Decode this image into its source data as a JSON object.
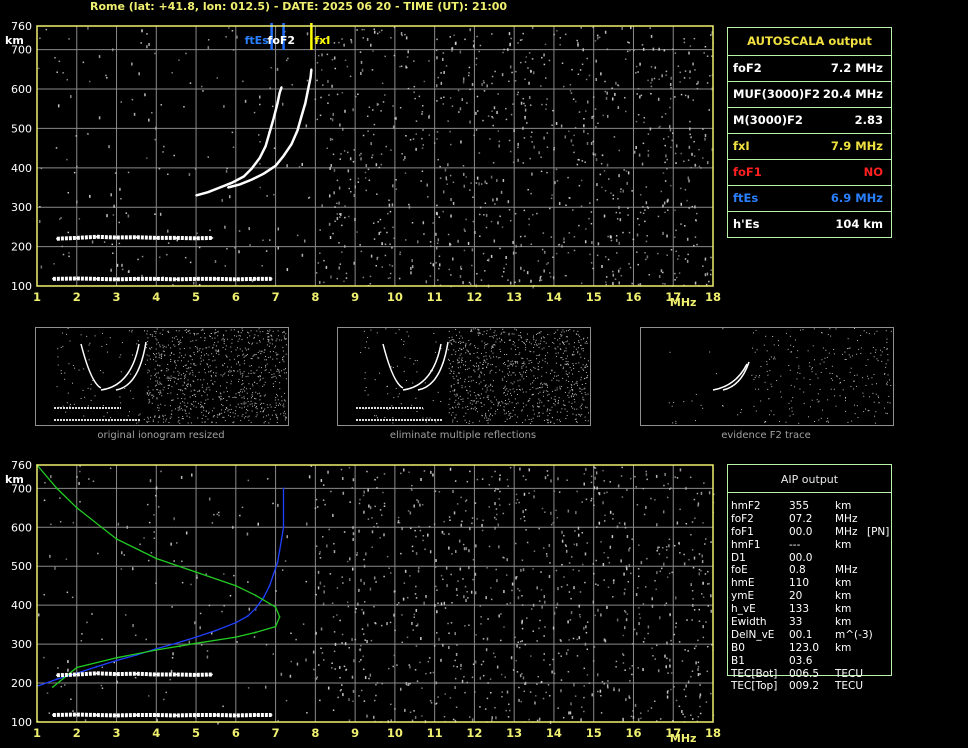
{
  "header": "Rome (lat: +41.8, lon: 012.5) - DATE: 2025 06 20 - TIME (UT): 21:00",
  "colors": {
    "grid": "#8a8a8a",
    "frame": "#f0f070",
    "trace": "#ffffff",
    "noise": "#cfcfcf",
    "profile": "#2040ff",
    "model": "#22cc22",
    "ftEs_marker": "#2070ff",
    "fxI_marker": "#ffff00"
  },
  "chart_data": [
    {
      "type": "scatter",
      "id": "top-ionogram",
      "title": "",
      "xlabel": "MHz",
      "ylabel": "km",
      "xlim": [
        1,
        18
      ],
      "ylim": [
        100,
        760
      ],
      "x_ticks": [
        1,
        2,
        3,
        4,
        5,
        6,
        7,
        8,
        9,
        10,
        11,
        12,
        13,
        14,
        15,
        16,
        17,
        18
      ],
      "y_ticks": [
        100,
        200,
        300,
        400,
        500,
        600,
        700,
        760
      ],
      "grid": true,
      "markers": [
        {
          "label": "ftEs",
          "x": 6.9,
          "color": "#2070ff"
        },
        {
          "label": "foF2",
          "x": 7.2,
          "color": "#2070ff"
        },
        {
          "label": "fxI",
          "x": 7.9,
          "color": "#ffff00"
        }
      ],
      "series": [
        {
          "x": [
            5.0,
            5.3,
            5.6,
            5.9,
            6.2,
            6.4,
            6.6,
            6.75,
            6.85,
            6.95,
            7.05,
            7.1,
            7.15
          ],
          "y": [
            330,
            338,
            350,
            362,
            378,
            398,
            425,
            455,
            490,
            525,
            565,
            590,
            605
          ]
        },
        {
          "x": [
            5.8,
            6.1,
            6.4,
            6.7,
            7.0,
            7.2,
            7.4,
            7.55,
            7.65,
            7.75,
            7.82,
            7.88,
            7.9
          ],
          "y": [
            350,
            358,
            370,
            385,
            405,
            430,
            460,
            495,
            530,
            565,
            600,
            630,
            650
          ]
        },
        {
          "x": [
            1.5,
            2.0,
            2.5,
            3.0,
            3.5,
            4.0,
            4.5,
            5.0,
            5.4
          ],
          "y": [
            220,
            222,
            225,
            223,
            224,
            222,
            222,
            221,
            222
          ]
        },
        {
          "x": [
            1.4,
            2.0,
            2.5,
            3.0,
            3.5,
            4.0,
            4.5,
            5.0,
            5.5,
            6.0,
            6.5,
            6.9
          ],
          "y": [
            118,
            119,
            118,
            117,
            118,
            118,
            117,
            118,
            118,
            117,
            118,
            118
          ]
        }
      ]
    },
    {
      "type": "scatter",
      "id": "bottom-ionogram",
      "title": "",
      "xlabel": "MHz",
      "ylabel": "km",
      "xlim": [
        1,
        18
      ],
      "ylim": [
        100,
        760
      ],
      "x_ticks": [
        1,
        2,
        3,
        4,
        5,
        6,
        7,
        8,
        9,
        10,
        11,
        12,
        13,
        14,
        15,
        16,
        17,
        18
      ],
      "y_ticks": [
        100,
        200,
        300,
        400,
        500,
        600,
        700,
        760
      ],
      "grid": true,
      "series": [
        {
          "x": [
            1.0,
            1.5,
            2.0,
            2.5,
            3.0,
            3.5,
            4.0,
            4.5,
            5.0,
            5.5,
            6.0,
            6.3,
            6.5,
            6.7,
            6.85,
            6.95,
            7.05,
            7.1,
            7.15,
            7.2,
            7.2
          ],
          "y": [
            192,
            210,
            225,
            242,
            258,
            272,
            288,
            302,
            318,
            335,
            355,
            372,
            392,
            420,
            450,
            480,
            510,
            540,
            570,
            600,
            700
          ]
        },
        {
          "x": [
            1.0,
            1.5,
            2.0,
            3.0,
            4.0,
            5.0,
            6.0,
            6.5,
            7.0,
            7.1,
            7.0,
            6.5,
            6.0,
            5.0,
            4.0,
            3.0,
            2.0,
            1.4
          ],
          "y": [
            760,
            700,
            650,
            570,
            520,
            485,
            450,
            425,
            395,
            370,
            345,
            330,
            318,
            302,
            285,
            265,
            240,
            190
          ]
        },
        {
          "x": [
            1.5,
            2.0,
            2.5,
            3.0,
            3.5,
            4.0,
            4.5,
            5.0,
            5.4
          ],
          "y": [
            220,
            222,
            225,
            223,
            224,
            222,
            222,
            221,
            222
          ]
        },
        {
          "x": [
            1.4,
            2.0,
            2.5,
            3.0,
            3.5,
            4.0,
            4.5,
            5.0,
            5.5,
            6.0,
            6.5,
            6.9
          ],
          "y": [
            118,
            119,
            118,
            117,
            118,
            118,
            117,
            118,
            118,
            117,
            118,
            118
          ]
        }
      ]
    }
  ],
  "autoscala": {
    "title": "AUTOSCALA output",
    "rows": [
      {
        "label": "foF2",
        "value": "7.2 MHz",
        "color": "#ffffff"
      },
      {
        "label": "MUF(3000)F2",
        "value": "20.4 MHz",
        "color": "#ffffff"
      },
      {
        "label": "M(3000)F2",
        "value": "2.83",
        "color": "#ffffff"
      },
      {
        "label": "fxI",
        "value": "7.9 MHz",
        "color": "#f0e040"
      },
      {
        "label": "foF1",
        "value": "NO",
        "color": "#ff2020"
      },
      {
        "label": "ftEs",
        "value": "6.9 MHz",
        "color": "#2a7fff"
      },
      {
        "label": "h'Es",
        "value": "104    km",
        "color": "#ffffff"
      }
    ]
  },
  "thumbnails": [
    {
      "caption": "original ionogram resized"
    },
    {
      "caption": "eliminate multiple reflections"
    },
    {
      "caption": "evidence F2 trace"
    }
  ],
  "aip": {
    "title": "AIP output",
    "rows": [
      {
        "name": "hmF2",
        "value": "355",
        "unit": "km",
        "extra": ""
      },
      {
        "name": "foF2",
        "value": "07.2",
        "unit": "MHz",
        "extra": ""
      },
      {
        "name": "foF1",
        "value": "00.0",
        "unit": "MHz",
        "extra": "[PN]"
      },
      {
        "name": "hmF1",
        "value": "---",
        "unit": "km",
        "extra": ""
      },
      {
        "name": "D1",
        "value": "00.0",
        "unit": "",
        "extra": ""
      },
      {
        "name": "foE",
        "value": "0.8",
        "unit": "MHz",
        "extra": ""
      },
      {
        "name": "hmE",
        "value": "110",
        "unit": "km",
        "extra": ""
      },
      {
        "name": "ymE",
        "value": "20",
        "unit": "km",
        "extra": ""
      },
      {
        "name": "h_vE",
        "value": "133",
        "unit": "km",
        "extra": ""
      },
      {
        "name": "Ewidth",
        "value": "33",
        "unit": "km",
        "extra": ""
      },
      {
        "name": "DelN_vE",
        "value": "00.1",
        "unit": "m^(-3)",
        "extra": ""
      },
      {
        "name": "B0",
        "value": "123.0",
        "unit": "km",
        "extra": ""
      },
      {
        "name": "B1",
        "value": "03.6",
        "unit": "",
        "extra": ""
      },
      {
        "name": "TEC[Bot]",
        "value": "006.5",
        "unit": "TECU",
        "extra": ""
      },
      {
        "name": "TEC[Top]",
        "value": "009.2",
        "unit": "TECU",
        "extra": ""
      }
    ]
  }
}
